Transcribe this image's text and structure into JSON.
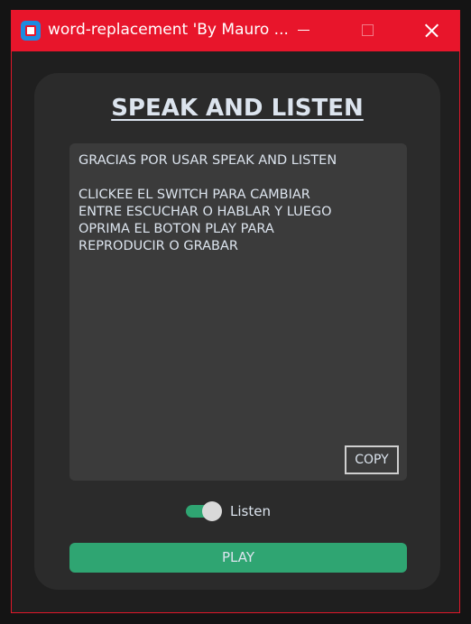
{
  "window": {
    "title": "word-replacement 'By Mauro ...",
    "accent_color": "#e8152b",
    "icon": "app-icon"
  },
  "controls": {
    "minimize_icon": "minimize-icon",
    "maximize_icon": "maximize-icon",
    "close_icon": "close-icon"
  },
  "main": {
    "heading": "SPEAK AND LISTEN",
    "textbox_value": "GRACIAS POR USAR SPEAK AND LISTEN\n\nCLICKEE EL SWITCH PARA CAMBIAR\nENTRE ESCUCHAR O HABLAR Y LUEGO\nOPRIMA EL BOTON PLAY PARA\nREPRODUCIR O GRABAR",
    "copy_label": "COPY",
    "switch": {
      "label": "Listen",
      "on": true,
      "color": "#2fa572"
    },
    "play_label": "PLAY"
  }
}
